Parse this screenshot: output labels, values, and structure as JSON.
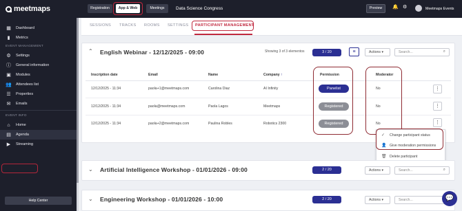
{
  "sidebar": {
    "logo": "meetmaps",
    "items_top": [
      {
        "label": "Dashboard",
        "icon": "grid-icon"
      },
      {
        "label": "Metrics",
        "icon": "bar-chart-icon"
      }
    ],
    "section_event_management": "EVENT MANAGEMENT",
    "items_mgmt": [
      {
        "label": "Settings",
        "icon": "gear-icon"
      },
      {
        "label": "General information",
        "icon": "info-icon"
      },
      {
        "label": "Modules",
        "icon": "modules-icon"
      },
      {
        "label": "Attendees list",
        "icon": "users-icon"
      },
      {
        "label": "Properties",
        "icon": "properties-icon"
      },
      {
        "label": "Emails",
        "icon": "mail-icon"
      }
    ],
    "section_event_info": "EVENT INFO",
    "items_info": [
      {
        "label": "Home",
        "icon": "home-icon"
      },
      {
        "label": "Agenda",
        "icon": "calendar-icon"
      },
      {
        "label": "Streaming",
        "icon": "streaming-icon"
      }
    ],
    "help": "Help Center"
  },
  "topbar": {
    "registration": "Registration",
    "app_web": "App & Web",
    "meetings": "Meetings",
    "event_title": "Data Science Congress",
    "preview": "Preview",
    "account": "Meetmaps Events"
  },
  "tabs": [
    "SESSIONS",
    "TRACKS",
    "ROOMS",
    "SETTINGS",
    "PARTICIPANT MANAGEMENT"
  ],
  "session1": {
    "title": "English Webinar - 12/12/2025 - 09:00",
    "showing": "Showing 3 of 3 elementos",
    "count": "3 / 20",
    "actions": "Actions",
    "search_placeholder": "Search...",
    "columns": [
      "Inscription date",
      "Email",
      "Name",
      "Company",
      "Permission",
      "Moderator"
    ],
    "rows": [
      {
        "date": "12/12/2025 - 11:34",
        "email": "paola+1@meetmaps.com",
        "name": "Carolina Diaz",
        "company": "AI Infinity",
        "permission": "Panelist",
        "moderator": "No"
      },
      {
        "date": "12/12/2025 - 11:34",
        "email": "paola@meetmaps.com",
        "name": "Paola Lagos",
        "company": "Meetmaps",
        "permission": "Registered",
        "moderator": "No"
      },
      {
        "date": "12/12/2025 - 11:34",
        "email": "paola+2@meetmaps.com",
        "name": "Paulina Robles",
        "company": "Robotics 2300",
        "permission": "Registered",
        "moderator": "No"
      }
    ]
  },
  "context_menu": [
    {
      "label": "Change participant status",
      "icon": "check-icon"
    },
    {
      "label": "Give moderation permissions",
      "icon": "user-shield-icon"
    },
    {
      "label": "Delete participant",
      "icon": "trash-icon"
    }
  ],
  "session2": {
    "title": "Artificial Intelligence Workshop - 01/01/2026 - 09:00",
    "count": "2 / 20",
    "actions": "Actions",
    "search_placeholder": "Search..."
  },
  "session3": {
    "title": "Engineering Workshop - 01/01/2026 - 10:00",
    "count": "2 / 20",
    "actions": "Actions",
    "search_placeholder": "Search..."
  },
  "colors": {
    "brand_navy": "#1d1f2b",
    "accent_blue": "#2b2f93",
    "highlight_red": "#c0283e"
  }
}
